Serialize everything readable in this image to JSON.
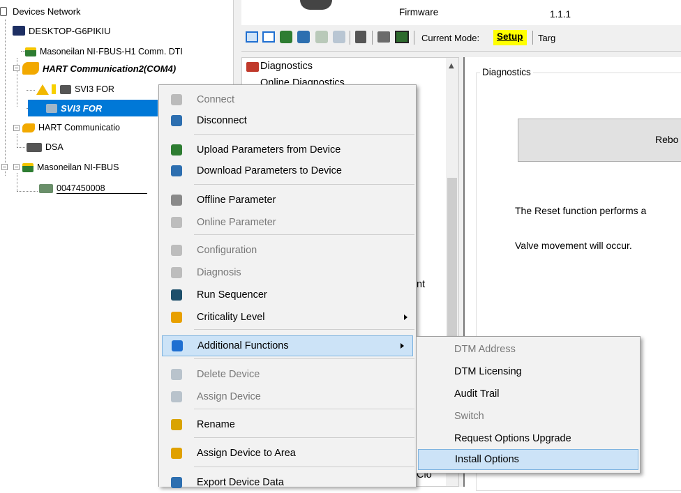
{
  "tree": {
    "root": "Devices Network",
    "desktop": "DESKTOP-G6PIKIU",
    "comm_dtm": "Masoneilan NI-FBUS-H1 Comm. DTI",
    "hart2": "HART Communication2(COM4)",
    "svi3_child": "SVI3 FOR",
    "svi3_selected": "SVI3 FOR",
    "hart": "HART Communicatio",
    "dsa": "DSA",
    "nifbus": "Masoneilan NI-FBUS",
    "device_id": "0047450008"
  },
  "header": {
    "firmware_label": "Firmware",
    "firmware_value": "1.1.1"
  },
  "toolbar": {
    "mode_label": "Current Mode:",
    "mode_value": "Setup",
    "target_label": "Targ",
    "mode_color": "#ffff00"
  },
  "nav": {
    "diagnostics": "Diagnostics",
    "online_diagnostics": "Online Diagnostics",
    "partial_text": "nt",
    "close_partial": "Clo"
  },
  "panel": {
    "group_title": "Diagnostics",
    "reboot_button": "Rebo",
    "reset_text": "The Reset function performs a",
    "valve_text": "Valve movement will occur."
  },
  "context_menu": {
    "items": [
      {
        "label": "Connect",
        "disabled": true,
        "icon": "connect-icon"
      },
      {
        "label": "Disconnect",
        "disabled": false,
        "icon": "disconnect-icon"
      },
      {
        "label": "Upload Parameters from Device",
        "disabled": false,
        "icon": "upload-icon"
      },
      {
        "label": "Download Parameters to Device",
        "disabled": false,
        "icon": "download-icon"
      },
      {
        "label": "Offline Parameter",
        "disabled": false,
        "icon": "offline-parameter-icon"
      },
      {
        "label": "Online Parameter",
        "disabled": true,
        "icon": "online-parameter-icon"
      },
      {
        "label": "Configuration",
        "disabled": true,
        "icon": "configuration-icon"
      },
      {
        "label": "Diagnosis",
        "disabled": true,
        "icon": "diagnosis-icon"
      },
      {
        "label": "Run Sequencer",
        "disabled": false,
        "icon": "sequencer-icon"
      },
      {
        "label": "Criticality Level",
        "disabled": false,
        "icon": "criticality-icon"
      },
      {
        "label": "Additional Functions",
        "disabled": false,
        "icon": "functions-icon"
      },
      {
        "label": "Delete Device",
        "disabled": true,
        "icon": "delete-device-icon"
      },
      {
        "label": "Assign Device",
        "disabled": true,
        "icon": "assign-device-icon"
      },
      {
        "label": "Rename",
        "disabled": false,
        "icon": "rename-icon"
      },
      {
        "label": "Assign Device to Area",
        "disabled": false,
        "icon": "assign-area-icon"
      },
      {
        "label": "Export Device Data",
        "disabled": false,
        "icon": "export-icon"
      }
    ]
  },
  "submenu": {
    "items": [
      {
        "label": "DTM Address",
        "disabled": true
      },
      {
        "label": "DTM Licensing",
        "disabled": false
      },
      {
        "label": "Audit Trail",
        "disabled": false
      },
      {
        "label": "Switch",
        "disabled": true
      },
      {
        "label": "Request Options Upgrade",
        "disabled": false
      },
      {
        "label": "Install Options",
        "disabled": false
      }
    ]
  }
}
